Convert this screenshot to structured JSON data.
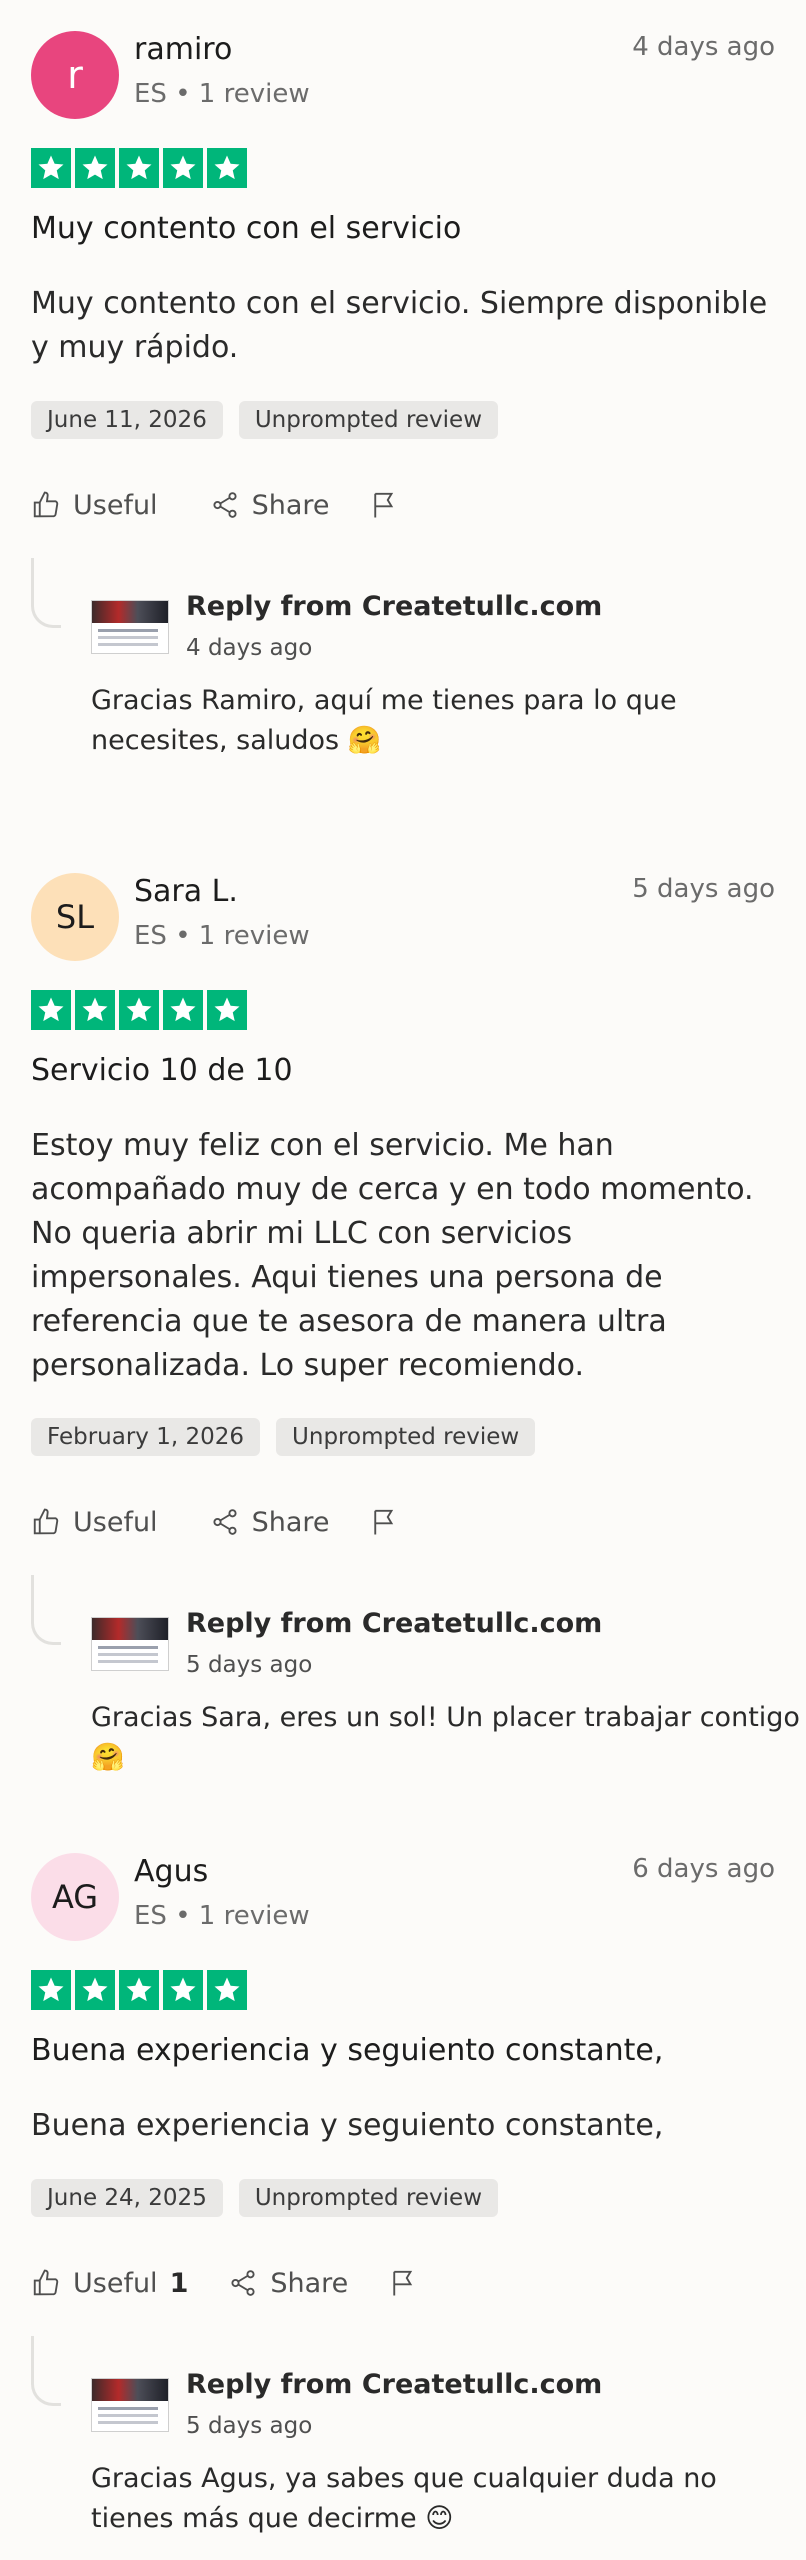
{
  "actions": {
    "useful_label": "Useful",
    "share_label": "Share"
  },
  "reviews": [
    {
      "avatar": {
        "initials": "r",
        "bg": "#e8457e"
      },
      "name": "ramiro",
      "meta": "ES • 1 review",
      "time_ago": "4 days ago",
      "rating": 5,
      "title": "Muy contento con el servicio",
      "body": "Muy contento con el servicio. Siempre disponible y muy rápido.",
      "date": "June 11, 2026",
      "tag": "Unprompted review",
      "useful_count": "",
      "reply": {
        "from": "Reply from Createtullc.com",
        "time_ago": "4 days ago",
        "text": "Gracias Ramiro, aquí me tienes para lo que necesites, saludos 🤗"
      }
    },
    {
      "avatar": {
        "initials": "SL",
        "bg": "#fde0b8"
      },
      "name": "Sara L.",
      "meta": "ES • 1 review",
      "time_ago": "5 days ago",
      "rating": 5,
      "title": "Servicio 10 de 10",
      "body": "Estoy muy feliz con el servicio. Me han acompañado muy de cerca y en todo momento. No queria abrir mi LLC con servicios impersonales. Aqui tienes una persona de referencia que te asesora de manera ultra personalizada. Lo super recomiendo.",
      "date": "February 1, 2026",
      "tag": "Unprompted review",
      "useful_count": "",
      "reply": {
        "from": "Reply from Createtullc.com",
        "time_ago": "5 days ago",
        "text": "Gracias Sara, eres un sol! Un placer trabajar contigo🤗"
      }
    },
    {
      "avatar": {
        "initials": "AG",
        "bg": "#fbdde8"
      },
      "name": "Agus",
      "meta": "ES • 1 review",
      "time_ago": "6 days ago",
      "rating": 5,
      "title": "Buena experiencia y seguiento constante,",
      "body": "Buena experiencia y seguiento constante,",
      "date": "June 24, 2025",
      "tag": "Unprompted review",
      "useful_count": "1",
      "reply": {
        "from": "Reply from Createtullc.com",
        "time_ago": "5 days ago",
        "text": "Gracias Agus, ya sabes que cualquier duda no tienes más que decirme 😊"
      }
    }
  ]
}
